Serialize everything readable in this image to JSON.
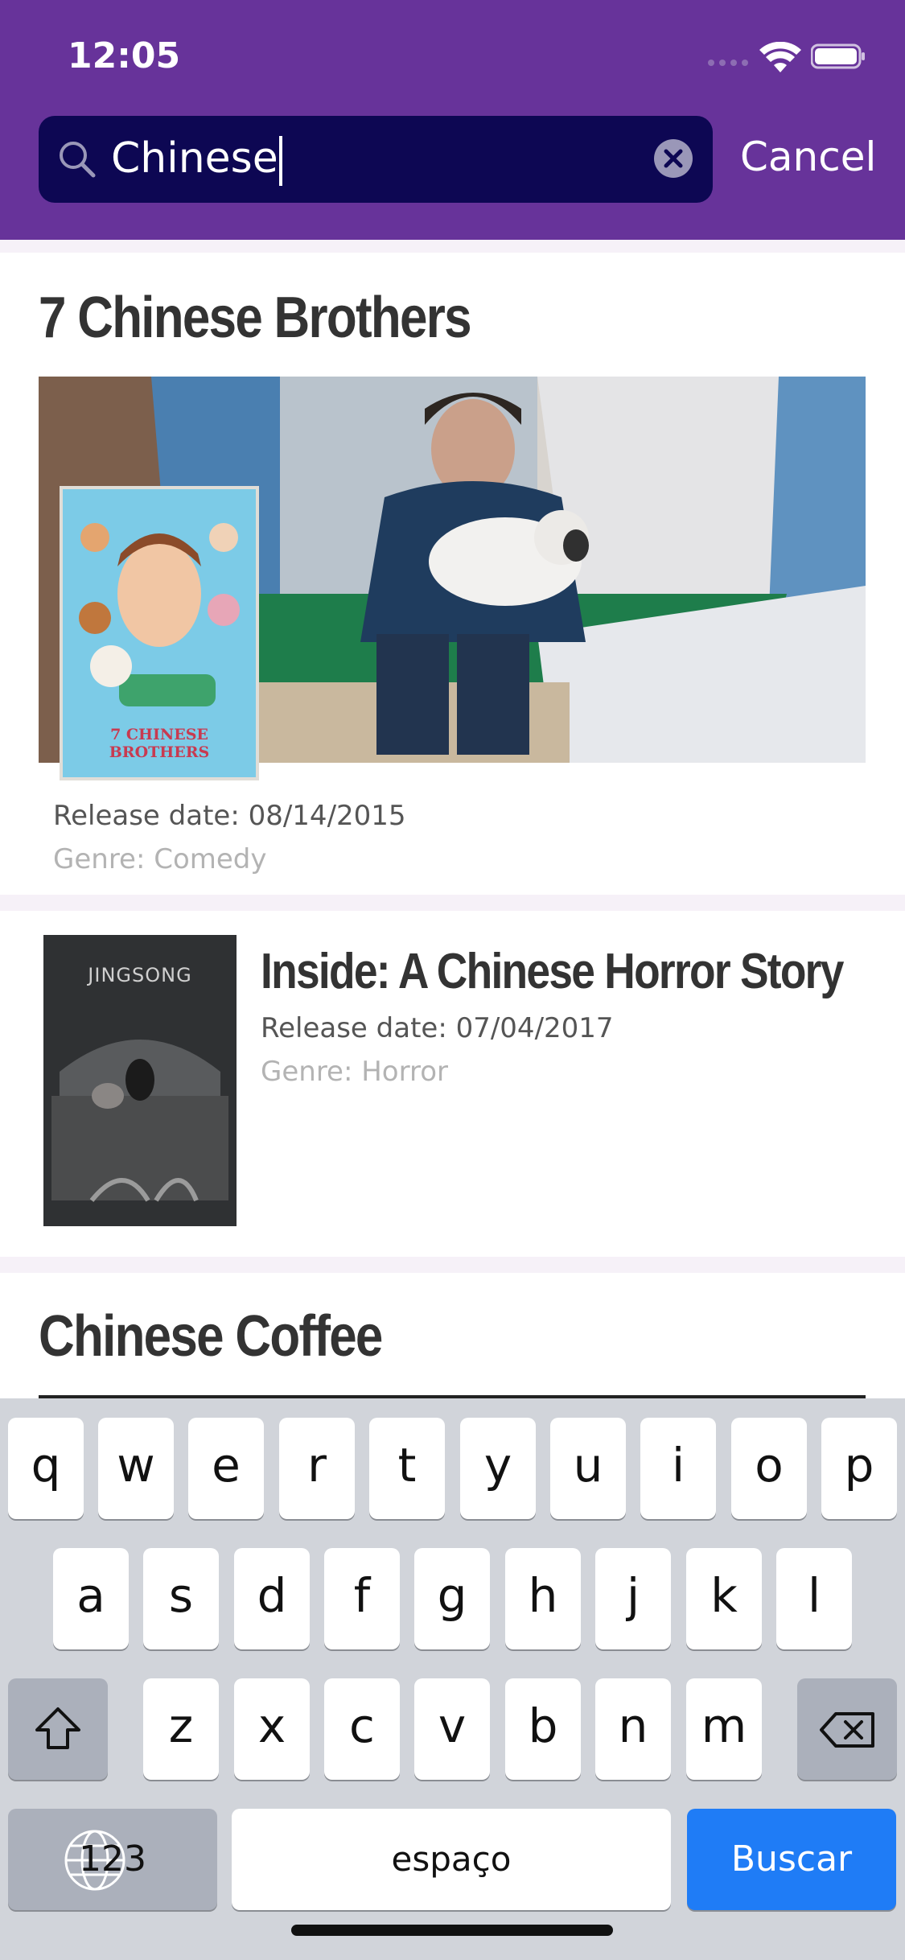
{
  "status_bar": {
    "time": "12:05"
  },
  "search": {
    "value": "Chinese",
    "cancel_label": "Cancel"
  },
  "results": [
    {
      "title": "7 Chinese Brothers",
      "release": "Release date: 08/14/2015",
      "genre": "Genre: Comedy",
      "poster_text": "7 CHINESE BROTHERS"
    },
    {
      "title": "Inside: A Chinese Horror Story",
      "release": "Release date: 07/04/2017",
      "genre": "Genre: Horror",
      "poster_text": "JINGSONG"
    },
    {
      "title": "Chinese Coffee"
    }
  ],
  "keyboard": {
    "row1": [
      "q",
      "w",
      "e",
      "r",
      "t",
      "y",
      "u",
      "i",
      "o",
      "p"
    ],
    "row2": [
      "a",
      "s",
      "d",
      "f",
      "g",
      "h",
      "j",
      "k",
      "l"
    ],
    "row3": [
      "z",
      "x",
      "c",
      "v",
      "b",
      "n",
      "m"
    ],
    "numbers_label": "123",
    "space_label": "espaço",
    "return_label": "Buscar"
  },
  "colors": {
    "header": "#67339a",
    "search_field": "#0d0753",
    "return_key": "#1f7cf6"
  },
  "icons": [
    "search-icon",
    "clear-icon",
    "wifi-icon",
    "battery-icon",
    "shift-icon",
    "backspace-icon",
    "globe-icon"
  ]
}
